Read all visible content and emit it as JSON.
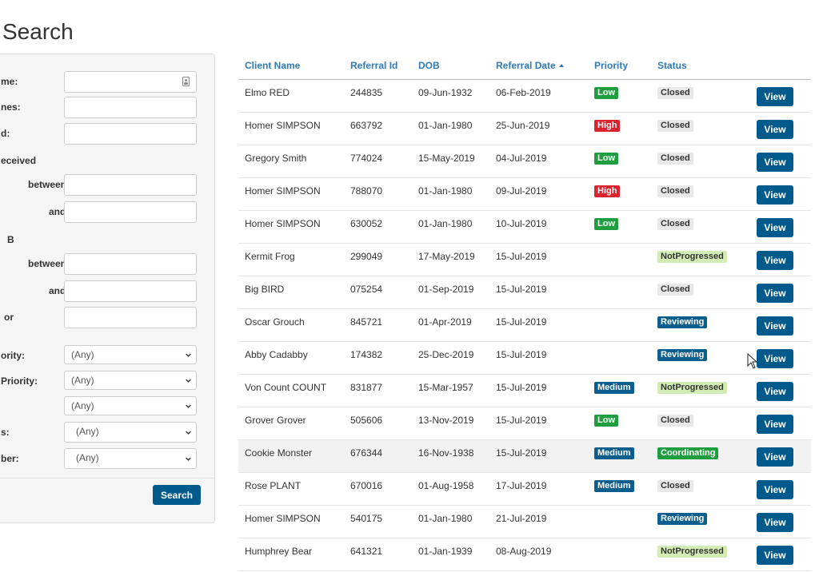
{
  "page": {
    "title": "Search"
  },
  "filters": {
    "labels": {
      "name": "me:",
      "names": "nes:",
      "id": "d:",
      "received": "eceived",
      "between1": "between:",
      "and1": "and:",
      "dob": "B",
      "between2": "between:",
      "and2": "and:",
      "or": "or",
      "priority": "ority:",
      "priority2": "Priority:",
      "status": "s:",
      "number": "ber:"
    },
    "selects": {
      "priority": "(Any)",
      "priority2": "(Any)",
      "select3": "(Any)",
      "status": "(Any)",
      "number": "(Any)"
    },
    "search_label": "Search"
  },
  "table": {
    "headers": {
      "client_name": "Client Name",
      "referral_id": "Referral Id",
      "dob": "DOB",
      "referral_date": "Referral Date",
      "priority": "Priority",
      "status": "Status"
    },
    "view_label": "View",
    "rows": [
      {
        "client_name": "Elmo RED",
        "referral_id": "244835",
        "dob": "09-Jun-1932",
        "referral_date": "06-Feb-2019",
        "priority": "Low",
        "status": "Closed"
      },
      {
        "client_name": "Homer SIMPSON",
        "referral_id": "663792",
        "dob": "01-Jan-1980",
        "referral_date": "25-Jun-2019",
        "priority": "High",
        "status": "Closed"
      },
      {
        "client_name": "Gregory Smith",
        "referral_id": "774024",
        "dob": "15-May-2019",
        "referral_date": "04-Jul-2019",
        "priority": "Low",
        "status": "Closed"
      },
      {
        "client_name": "Homer SIMPSON",
        "referral_id": "788070",
        "dob": "01-Jan-1980",
        "referral_date": "09-Jul-2019",
        "priority": "High",
        "status": "Closed"
      },
      {
        "client_name": "Homer SIMPSON",
        "referral_id": "630052",
        "dob": "01-Jan-1980",
        "referral_date": "10-Jul-2019",
        "priority": "Low",
        "status": "Closed"
      },
      {
        "client_name": "Kermit Frog",
        "referral_id": "299049",
        "dob": "17-May-2019",
        "referral_date": "15-Jul-2019",
        "priority": "",
        "status": "NotProgressed"
      },
      {
        "client_name": "Big BIRD",
        "referral_id": "075254",
        "dob": "01-Sep-2019",
        "referral_date": "15-Jul-2019",
        "priority": "",
        "status": "Closed"
      },
      {
        "client_name": "Oscar Grouch",
        "referral_id": "845721",
        "dob": "01-Apr-2019",
        "referral_date": "15-Jul-2019",
        "priority": "",
        "status": "Reviewing"
      },
      {
        "client_name": "Abby Cadabby",
        "referral_id": "174382",
        "dob": "25-Dec-2019",
        "referral_date": "15-Jul-2019",
        "priority": "",
        "status": "Reviewing"
      },
      {
        "client_name": "Von Count COUNT",
        "referral_id": "831877",
        "dob": "15-Mar-1957",
        "referral_date": "15-Jul-2019",
        "priority": "Medium",
        "status": "NotProgressed"
      },
      {
        "client_name": "Grover Grover",
        "referral_id": "505606",
        "dob": "13-Nov-2019",
        "referral_date": "15-Jul-2019",
        "priority": "Low",
        "status": "Closed"
      },
      {
        "client_name": "Cookie Monster",
        "referral_id": "676344",
        "dob": "16-Nov-1938",
        "referral_date": "15-Jul-2019",
        "priority": "Medium",
        "status": "Coordinating"
      },
      {
        "client_name": "Rose PLANT",
        "referral_id": "670016",
        "dob": "01-Aug-1958",
        "referral_date": "17-Jul-2019",
        "priority": "Medium",
        "status": "Closed"
      },
      {
        "client_name": "Homer SIMPSON",
        "referral_id": "540175",
        "dob": "01-Jan-1980",
        "referral_date": "21-Jul-2019",
        "priority": "",
        "status": "Reviewing"
      },
      {
        "client_name": "Humphrey Bear",
        "referral_id": "641321",
        "dob": "01-Jan-1939",
        "referral_date": "08-Aug-2019",
        "priority": "",
        "status": "NotProgressed"
      }
    ]
  },
  "colors": {
    "priority": {
      "Low": {
        "bg": "#1e9e3e",
        "fg": "#ffffff"
      },
      "High": {
        "bg": "#d9232e",
        "fg": "#ffffff"
      },
      "Medium": {
        "bg": "#0b5e8e",
        "fg": "#ffffff"
      }
    },
    "status": {
      "Closed": {
        "bg": "#e8e8e8",
        "fg": "#333333"
      },
      "NotProgressed": {
        "bg": "#d3ecb5",
        "fg": "#333333"
      },
      "Reviewing": {
        "bg": "#0b5e8e",
        "fg": "#ffffff"
      },
      "Coordinating": {
        "bg": "#1e9e3e",
        "fg": "#ffffff"
      }
    },
    "accent": "#005a8c",
    "header_link": "#2e79b9"
  }
}
